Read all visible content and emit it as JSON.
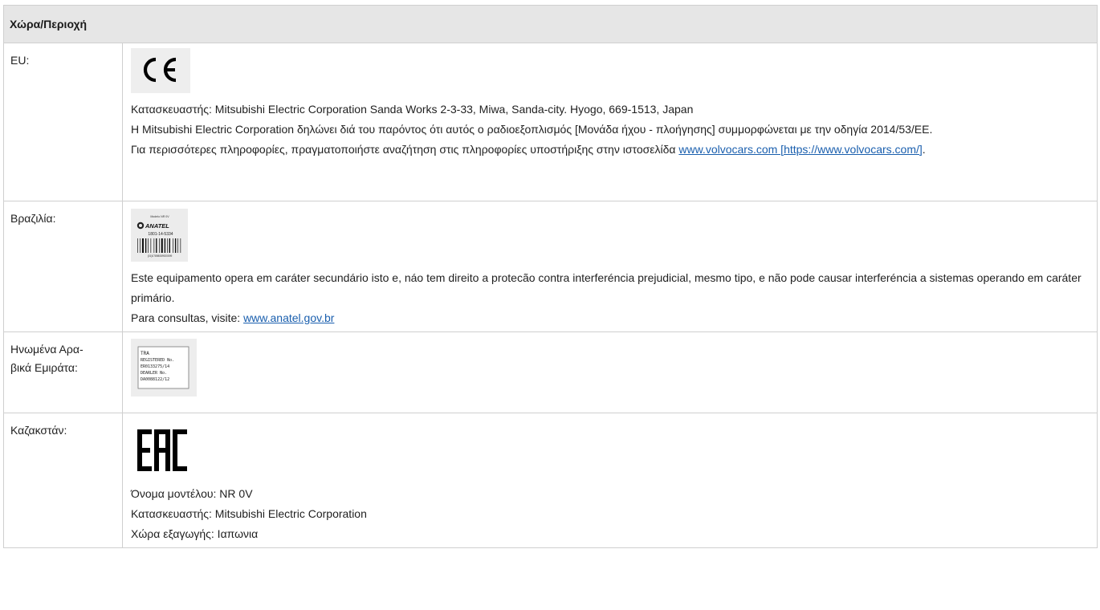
{
  "table": {
    "header": "Χώρα/Περιοχή",
    "rows": [
      {
        "country": "EU:",
        "logo": "ce-mark",
        "lines": [
          "Κατασκευαστής: Mitsubishi Electric Corporation Sanda Works 2-3-33, Miwa, Sanda-city. Hyogo, 669-1513, Japan",
          "Η Mitsubishi Electric Corporation δηλώνει διά του παρόντος ότι αυτός ο ραδιοεξοπλισμός [Μονάδα ήχου - πλοήγησης] συμμορφώνεται με την οδηγία 2014/53/EE."
        ],
        "more_info_text": "Για περισσότερες πληροφορίες, πραγματοποιήστε αναζήτηση στις πληροφορίες υποστήριξης στην ιστοσελίδα ",
        "link_text": "www.volvocars.com [https://www.volvocars.com/]",
        "link_suffix": "."
      },
      {
        "country": "Βραζιλία:",
        "logo": "anatel-label",
        "logo_text": {
          "model": "Modelo NR 0V",
          "brand": "ANATEL",
          "number": "1801-14-5334",
          "barcode_digits": "(01)07898089920599"
        },
        "lines": [
          "Este equipamento opera em caráter secundário isto e, náo tem direito a protecão contra interferéncia prejudicial, mesmo tipo, e não pode causar interferéncia a sistemas operando em caráter primário."
        ],
        "consult_text": "Para consultas, visite: ",
        "link_text": "www.anatel.gov.br"
      },
      {
        "country": "Ηνωμένα Αρα-βικά Εμιράτα:",
        "country_line1": "Ηνωμένα Αρα-",
        "country_line2": "βικά Εμιράτα:",
        "logo": "tra-label",
        "logo_text": {
          "l1": "TRA",
          "l2": "REGISTERED No.",
          "l3": "ER0133275/14",
          "l4": "DEARLER    No.",
          "l5": "DA0088122/12"
        }
      },
      {
        "country": "Καζακστάν:",
        "logo": "eac-mark",
        "lines": [
          "Όνομα μοντέλου: NR 0V",
          "Κατασκευαστής: Mitsubishi Electric Corporation",
          "Χώρα εξαγωγής: Ιαπωνια"
        ]
      }
    ]
  }
}
